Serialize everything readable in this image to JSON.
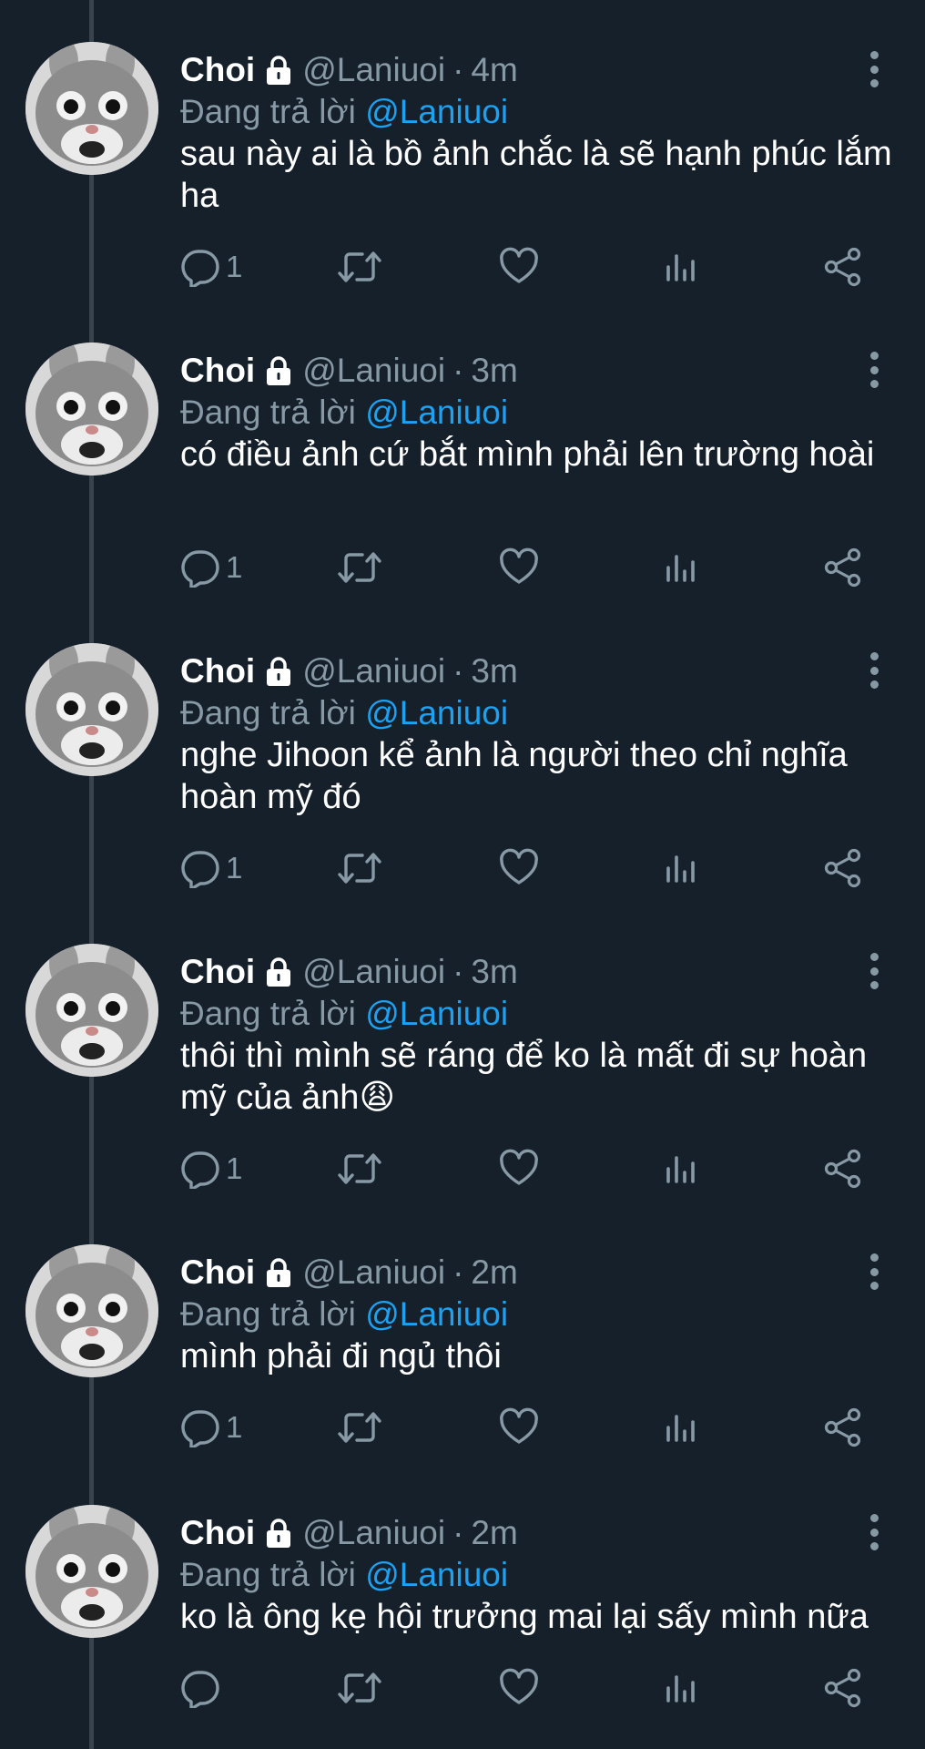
{
  "tweets": [
    {
      "name": "Choi",
      "handle": "@Laniuoi",
      "time": "4m",
      "reply_label": "Đang trả lời",
      "reply_handle": "@Laniuoi",
      "text": "sau này ai là bồ ảnh chắc là sẽ hạnh phúc lắm ha",
      "reply_count": "1"
    },
    {
      "name": "Choi",
      "handle": "@Laniuoi",
      "time": "3m",
      "reply_label": "Đang trả lời",
      "reply_handle": "@Laniuoi",
      "text": "có điều ảnh cứ bắt mình phải lên trường hoài",
      "reply_count": "1"
    },
    {
      "name": "Choi",
      "handle": "@Laniuoi",
      "time": "3m",
      "reply_label": "Đang trả lời",
      "reply_handle": "@Laniuoi",
      "text": "nghe Jihoon kể ảnh là người theo chỉ nghĩa hoàn mỹ đó",
      "reply_count": "1"
    },
    {
      "name": "Choi",
      "handle": "@Laniuoi",
      "time": "3m",
      "reply_label": "Đang trả lời",
      "reply_handle": "@Laniuoi",
      "text": "thôi thì mình sẽ ráng để ko là mất đi sự hoàn mỹ của ảnh😩",
      "reply_count": "1"
    },
    {
      "name": "Choi",
      "handle": "@Laniuoi",
      "time": "2m",
      "reply_label": "Đang trả lời",
      "reply_handle": "@Laniuoi",
      "text": "mình phải đi ngủ thôi",
      "reply_count": "1"
    },
    {
      "name": "Choi",
      "handle": "@Laniuoi",
      "time": "2m",
      "reply_label": "Đang trả lời",
      "reply_handle": "@Laniuoi",
      "text": "ko là ông kẹ hội trưởng mai lại sấy mình nữa",
      "reply_count": ""
    }
  ],
  "separator": "·",
  "icons": [
    "lock-icon",
    "more-icon",
    "reply-icon",
    "retweet-icon",
    "like-icon",
    "analytics-icon",
    "share-icon"
  ],
  "colors": {
    "background": "#15202b",
    "muted": "#8899a6",
    "accent": "#1da1f2",
    "thread_line": "#38444d"
  }
}
